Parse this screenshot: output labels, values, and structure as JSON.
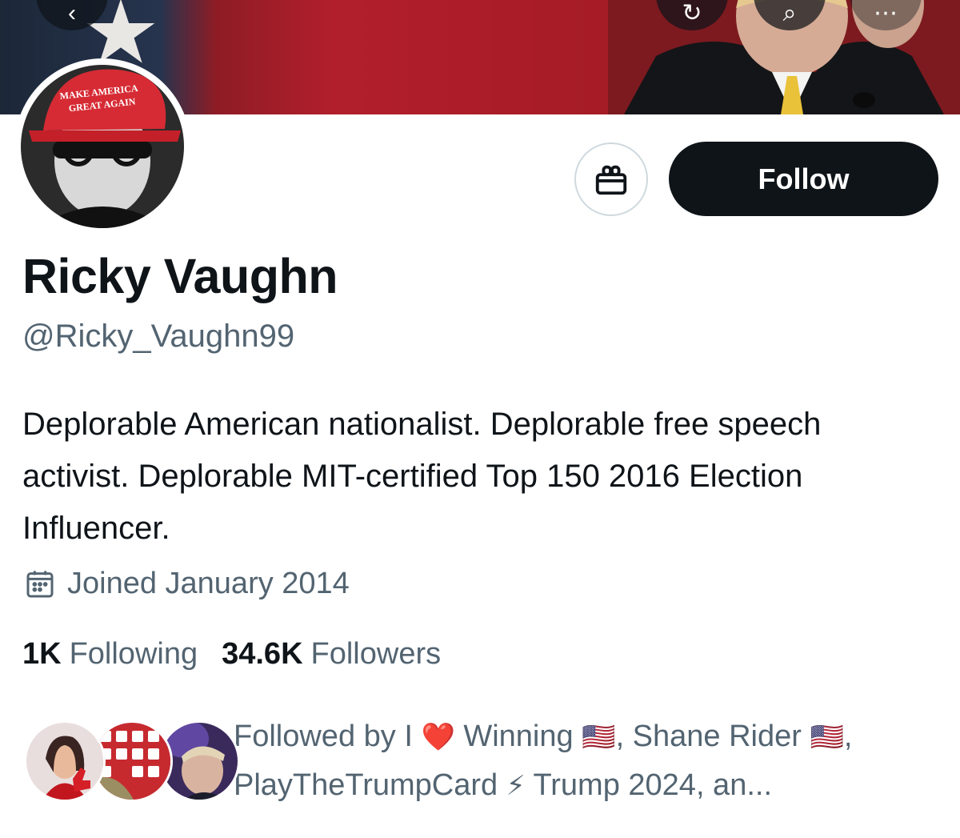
{
  "banner": {
    "back_icon": "chevron-left-icon",
    "refresh_icon": "refresh-icon",
    "search_icon": "search-icon",
    "more_icon": "more-icon",
    "colors": {
      "red": "#b21f2c",
      "navy": "#1c2738"
    }
  },
  "profile": {
    "avatar_hat_text_1": "MAKE AMERICA",
    "avatar_hat_text_2": "GREAT AGAIN",
    "name": "Ricky Vaughn",
    "handle": "@Ricky_Vaughn99",
    "bio": "Deplorable American nationalist. Deplorable free speech activist. Deplorable MIT-certified Top 150 2016 Election Influencer.",
    "joined": "Joined January 2014"
  },
  "actions": {
    "gift_icon": "gift-icon",
    "follow_label": "Follow"
  },
  "stats": {
    "following_count": "1K",
    "following_label": "Following",
    "followers_count": "34.6K",
    "followers_label": "Followers"
  },
  "followed_by": {
    "prefix": "Followed by I",
    "heart": "❤️",
    "winning": "Winning",
    "flag": "🇺🇸",
    "shane": ", Shane Rider",
    "separator": ", ",
    "trumpcard": "PlayTheTrumpCard",
    "bolt": "⚡",
    "trump2024": "Trump 2024, an..."
  },
  "colors": {
    "text_primary": "#0f1419",
    "text_secondary": "#536471",
    "button_dark": "#0f1419",
    "border": "#cfd9de"
  }
}
